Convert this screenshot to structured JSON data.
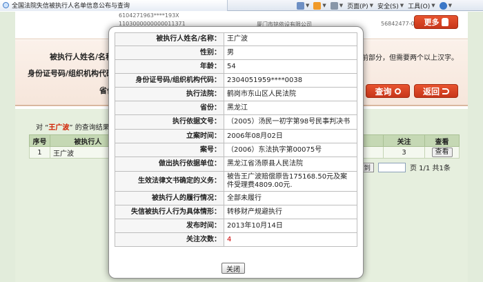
{
  "browser": {
    "tab_title": "全国法院失信被执行人名单信息公布与查询",
    "toolbar": {
      "home_label": "",
      "page_label": "页面(P)",
      "safety_label": "安全(S)",
      "tools_label": "工具(O)",
      "help_label": ""
    }
  },
  "upper_rows": [
    {
      "code": "6104271963****193X",
      "more_label": "更多"
    },
    {
      "code": "1103000000000011371",
      "org": "厦门市铭依设有限公司",
      "code2": "56842477-0",
      "more_label": "更多"
    }
  ],
  "search": {
    "name_label": "被执行人姓名/名称：",
    "id_label": "身份证号码/组织机构代码：",
    "province_label": "省份：",
    "hint": "前部分，但需要两个以上汉字。",
    "query_label": "查询",
    "back_label": "返回"
  },
  "results": {
    "prefix": "对 “",
    "name": "王广波",
    "suffix": "” 的查询结果",
    "headers": {
      "index": "序号",
      "name": "被执行人",
      "attention": "关注",
      "view": "查看"
    },
    "rows": [
      {
        "index": "1",
        "name": "王广波",
        "attention": "3",
        "view_label": "查看"
      }
    ],
    "pager": {
      "goto_label": "到",
      "info": "页 1/1 共1条"
    }
  },
  "detail": {
    "rows": [
      {
        "label": "被执行人姓名/名称：",
        "value": "王广波"
      },
      {
        "label": "性别：",
        "value": "男"
      },
      {
        "label": "年龄：",
        "value": "54"
      },
      {
        "label": "身份证号码/组织机构代码：",
        "value": "2304051959****0038"
      },
      {
        "label": "执行法院：",
        "value": "鹤岗市东山区人民法院"
      },
      {
        "label": "省份：",
        "value": "黑龙江"
      },
      {
        "label": "执行依据文号：",
        "value": "（2005）汤民一初字第98号民事判决书"
      },
      {
        "label": "立案时间：",
        "value": "2006年08月02日"
      },
      {
        "label": "案号：",
        "value": "（2006）东法执字第00075号"
      },
      {
        "label": "做出执行依据单位：",
        "value": "黑龙江省汤原县人民法院"
      },
      {
        "label": "生效法律文书确定的义务：",
        "value": "被告王广波赔偿原告175168.50元及案件受理费4809.00元."
      },
      {
        "label": "被执行人的履行情况：",
        "value": "全部未履行"
      },
      {
        "label": "失信被执行人行为具体情形：",
        "value": "转移财产规避执行"
      },
      {
        "label": "发布时间：",
        "value": "2013年10月14日"
      },
      {
        "label": "关注次数：",
        "value": "4",
        "red": true
      }
    ],
    "close_label": "关闭"
  }
}
